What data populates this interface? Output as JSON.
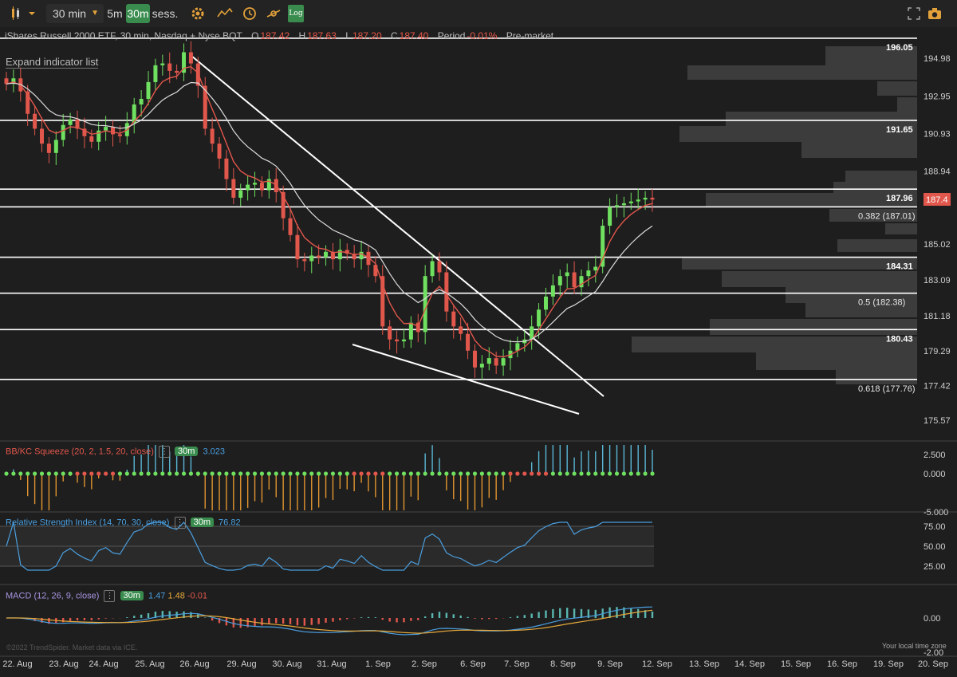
{
  "toolbar": {
    "timeframe_label": "30 min",
    "btn_5m": "5m",
    "btn_30m": "30m",
    "btn_sess": "sess.",
    "log_label": "Log"
  },
  "header": {
    "title": "iShares Russell 2000 ETF, 30 min, Nasdaq + Nyse BQT",
    "o_label": "O",
    "o_value": "187.42",
    "h_label": "H",
    "h_value": "187.63",
    "l_label": "L",
    "l_value": "187.20",
    "c_label": "C",
    "c_value": "187.40",
    "period_label": "Period",
    "period_value": "-0.01%",
    "session": "Pre-market"
  },
  "expand_label": "Expand indicator list",
  "indicators": {
    "squeeze": {
      "name": "BB/KC Squeeze (20, 2, 1.5, 20, close)",
      "tf": "30m",
      "value": "3.023"
    },
    "rsi": {
      "name": "Relative Strength Index (14, 70, 30, close)",
      "tf": "30m",
      "value": "76.82"
    },
    "macd": {
      "name": "MACD (12, 26, 9, close)",
      "tf": "30m",
      "v1": "1.47",
      "v2": "1.48",
      "v3": "-0.01"
    }
  },
  "footer": {
    "copyright": "©2022 TrendSpider. Market data via ICE.",
    "local_tz": "Your local time zone"
  },
  "colors": {
    "up": "#6fe05f",
    "down": "#e2574c",
    "accent": "#3a8c4e",
    "price_tag": "#e2574c",
    "squeeze_on": "#e2574c",
    "squeeze_off": "#6fe05f",
    "macd_line": "#4a9fe0",
    "signal_line": "#e8a93a",
    "rsi_line": "#4a9fe0"
  },
  "chart_data": {
    "type": "candlestick",
    "price_axis_labels": [
      "194.98",
      "192.95",
      "190.93",
      "188.94",
      "187.4",
      "185.02",
      "183.09",
      "181.18",
      "179.29",
      "177.42",
      "175.57"
    ],
    "current_price_tag": "187.4",
    "horizontal_levels": [
      {
        "price": 196.05,
        "label": "196.05"
      },
      {
        "price": 191.65,
        "label": "191.65"
      },
      {
        "price": 187.96,
        "label": "187.96"
      },
      {
        "price": 187.01,
        "label": "0.382 (187.01)"
      },
      {
        "price": 184.31,
        "label": "184.31"
      },
      {
        "price": 182.38,
        "label": "0.5 (182.38)"
      },
      {
        "price": 180.43,
        "label": "180.43"
      },
      {
        "price": 177.76,
        "label": "0.618 (177.76)"
      }
    ],
    "x_labels": [
      "22. Aug",
      "23. Aug",
      "24. Aug",
      "25. Aug",
      "26. Aug",
      "29. Aug",
      "30. Aug",
      "31. Aug",
      "1. Sep",
      "2. Sep",
      "6. Sep",
      "7. Sep",
      "8. Sep",
      "9. Sep",
      "12. Sep",
      "13. Sep",
      "14. Sep",
      "15. Sep",
      "16. Sep",
      "19. Sep",
      "20. Sep"
    ],
    "closes": [
      193.6,
      193.9,
      193.2,
      192.0,
      191.2,
      190.4,
      189.9,
      190.6,
      191.4,
      191.7,
      191.2,
      190.8,
      190.5,
      191.1,
      191.3,
      190.9,
      190.8,
      191.5,
      192.5,
      192.8,
      193.7,
      194.6,
      194.7,
      194.3,
      194.2,
      195.3,
      194.7,
      193.5,
      191.2,
      190.4,
      189.6,
      188.5,
      187.5,
      187.9,
      188.2,
      188.3,
      187.9,
      188.5,
      187.8,
      186.4,
      185.5,
      184.2,
      184.1,
      184.4,
      184.3,
      184.6,
      184.2,
      184.7,
      184.5,
      184.2,
      184.6,
      183.9,
      183.3,
      180.6,
      179.9,
      179.8,
      179.9,
      180.8,
      180.3,
      183.3,
      184.1,
      183.5,
      181.4,
      180.6,
      180.2,
      179.3,
      178.4,
      178.6,
      178.9,
      178.5,
      178.9,
      179.3,
      179.7,
      179.9,
      180.6,
      181.5,
      182.2,
      182.8,
      183.3,
      183.5,
      182.7,
      183.3,
      183.6,
      183.8,
      186.0,
      187.0,
      187.1,
      187.2,
      187.3,
      187.4,
      187.5,
      187.4
    ],
    "squeeze": {
      "values_range": [
        -5,
        2.5
      ],
      "ticks": [
        "2.500",
        "0.000",
        "-5.000"
      ],
      "last": 3.023
    },
    "rsi": {
      "ticks": [
        "75.00",
        "50.00",
        "25.00"
      ],
      "overbought": 70,
      "oversold": 30,
      "last": 76.82
    },
    "macd": {
      "ticks": [
        "0.00",
        "-2.00"
      ],
      "macd": 1.47,
      "signal": 1.48,
      "hist": -0.01
    }
  }
}
